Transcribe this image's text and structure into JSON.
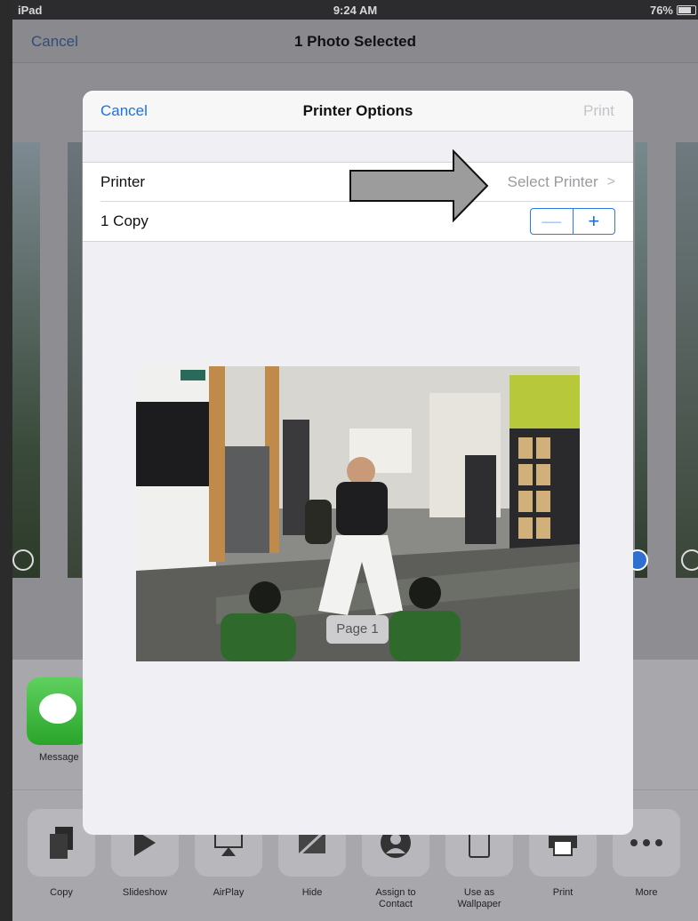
{
  "status_bar": {
    "carrier": "iPad",
    "time": "9:24 AM",
    "battery": "76%"
  },
  "background_nav": {
    "cancel_label": "Cancel",
    "title": "1 Photo Selected"
  },
  "share_apps": [
    {
      "label": "Message",
      "icon": "message-bubble-icon"
    }
  ],
  "share_actions": [
    {
      "label": "Copy",
      "icon": "copy-icon"
    },
    {
      "label": "Slideshow",
      "icon": "play-icon"
    },
    {
      "label": "AirPlay",
      "icon": "airplay-icon"
    },
    {
      "label": "Hide",
      "icon": "hide-icon"
    },
    {
      "label": "Assign to Contact",
      "icon": "contact-icon"
    },
    {
      "label": "Use as Wallpaper",
      "icon": "wallpaper-icon"
    },
    {
      "label": "Print",
      "icon": "printer-icon"
    },
    {
      "label": "More",
      "icon": "more-icon"
    }
  ],
  "printer_options": {
    "cancel_label": "Cancel",
    "title": "Printer Options",
    "print_label": "Print",
    "printer_label": "Printer",
    "select_printer_label": "Select Printer",
    "copies_label": "1 Copy",
    "stepper_minus": "—",
    "stepper_plus": "+",
    "page_label": "Page 1"
  },
  "colors": {
    "accent": "#1a73e8",
    "disabled": "#c4c4c8",
    "annotation_arrow": "#9c9c9c"
  }
}
